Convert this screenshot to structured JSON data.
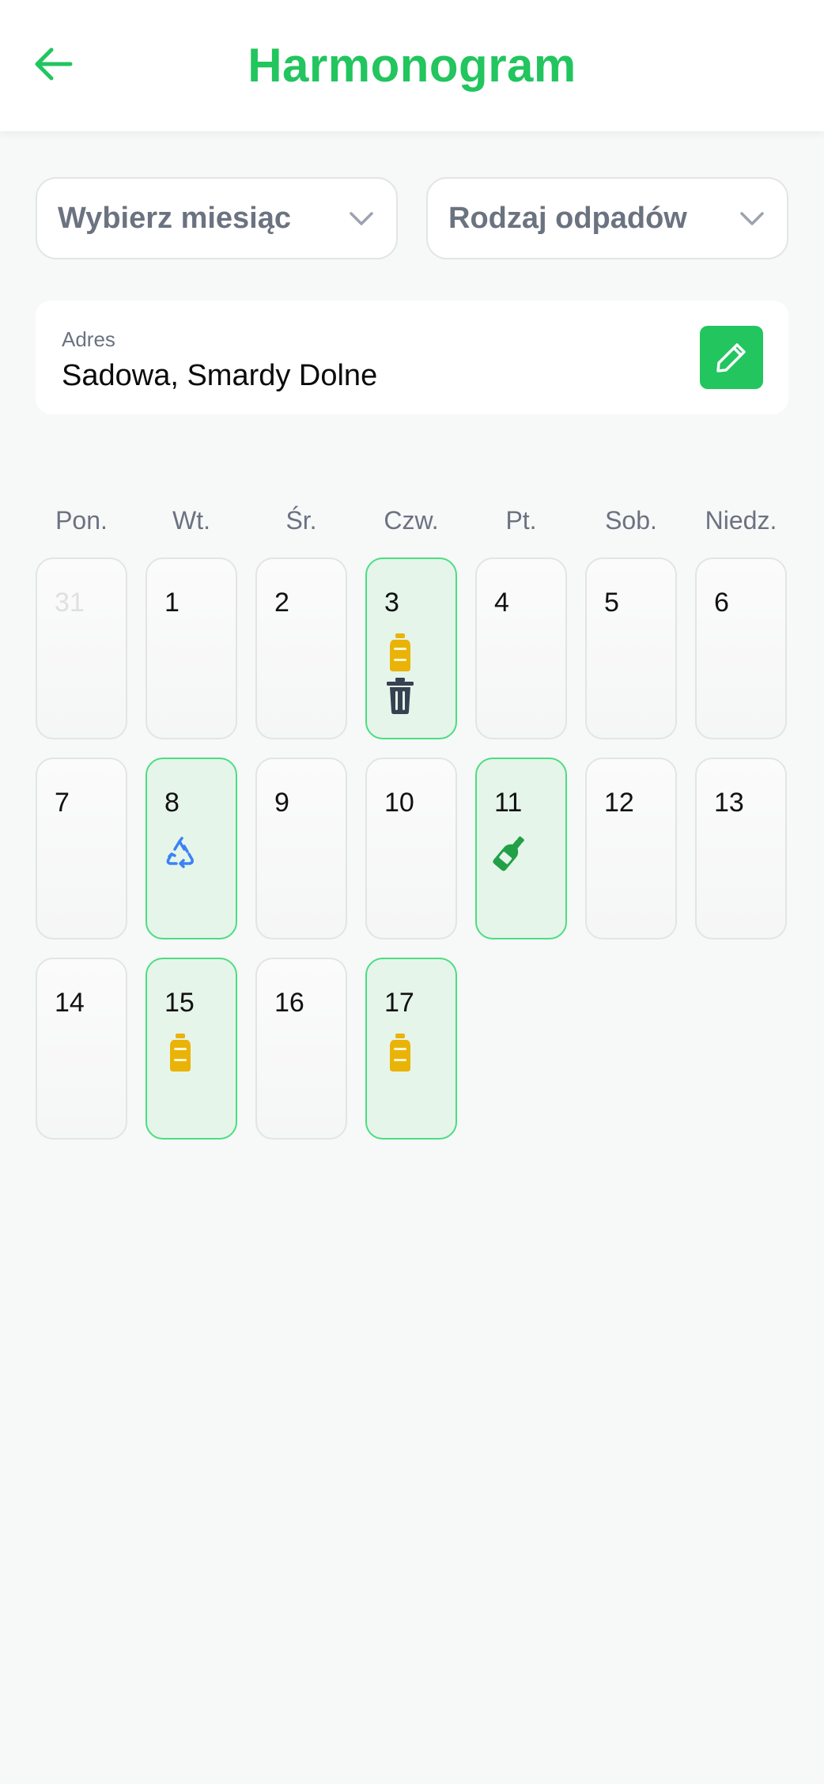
{
  "header": {
    "title": "Harmonogram",
    "back_icon": "arrow-left-icon"
  },
  "filters": {
    "month_label": "Wybierz miesiąc",
    "waste_label": "Rodzaj odpadów"
  },
  "address": {
    "label": "Adres",
    "value": "Sadowa, Smardy Dolne",
    "edit_icon": "pencil-icon"
  },
  "weekdays": [
    "Pon.",
    "Wt.",
    "Śr.",
    "Czw.",
    "Pt.",
    "Sob.",
    "Niedz."
  ],
  "days": [
    {
      "num": "31",
      "muted": true,
      "active": false,
      "icons": []
    },
    {
      "num": "1",
      "muted": false,
      "active": false,
      "icons": []
    },
    {
      "num": "2",
      "muted": false,
      "active": false,
      "icons": []
    },
    {
      "num": "3",
      "muted": false,
      "active": true,
      "icons": [
        "plastic-bottle-icon",
        "trash-bin-icon"
      ]
    },
    {
      "num": "4",
      "muted": false,
      "active": false,
      "icons": []
    },
    {
      "num": "5",
      "muted": false,
      "active": false,
      "icons": []
    },
    {
      "num": "6",
      "muted": false,
      "active": false,
      "icons": []
    },
    {
      "num": "7",
      "muted": false,
      "active": false,
      "icons": []
    },
    {
      "num": "8",
      "muted": false,
      "active": true,
      "icons": [
        "recycle-icon"
      ]
    },
    {
      "num": "9",
      "muted": false,
      "active": false,
      "icons": []
    },
    {
      "num": "10",
      "muted": false,
      "active": false,
      "icons": []
    },
    {
      "num": "11",
      "muted": false,
      "active": true,
      "icons": [
        "glass-bottle-icon"
      ]
    },
    {
      "num": "12",
      "muted": false,
      "active": false,
      "icons": []
    },
    {
      "num": "13",
      "muted": false,
      "active": false,
      "icons": []
    },
    {
      "num": "14",
      "muted": false,
      "active": false,
      "icons": []
    },
    {
      "num": "15",
      "muted": false,
      "active": true,
      "icons": [
        "plastic-bottle-icon"
      ]
    },
    {
      "num": "16",
      "muted": false,
      "active": false,
      "icons": []
    },
    {
      "num": "17",
      "muted": false,
      "active": true,
      "icons": [
        "plastic-bottle-icon"
      ]
    }
  ],
  "colors": {
    "accent": "#22c55e",
    "active_border": "#4ade80",
    "active_bg": "#e6f5ea",
    "plastic": "#eab308",
    "trash": "#374151",
    "recycle": "#3b82f6",
    "glass": "#22a047"
  }
}
